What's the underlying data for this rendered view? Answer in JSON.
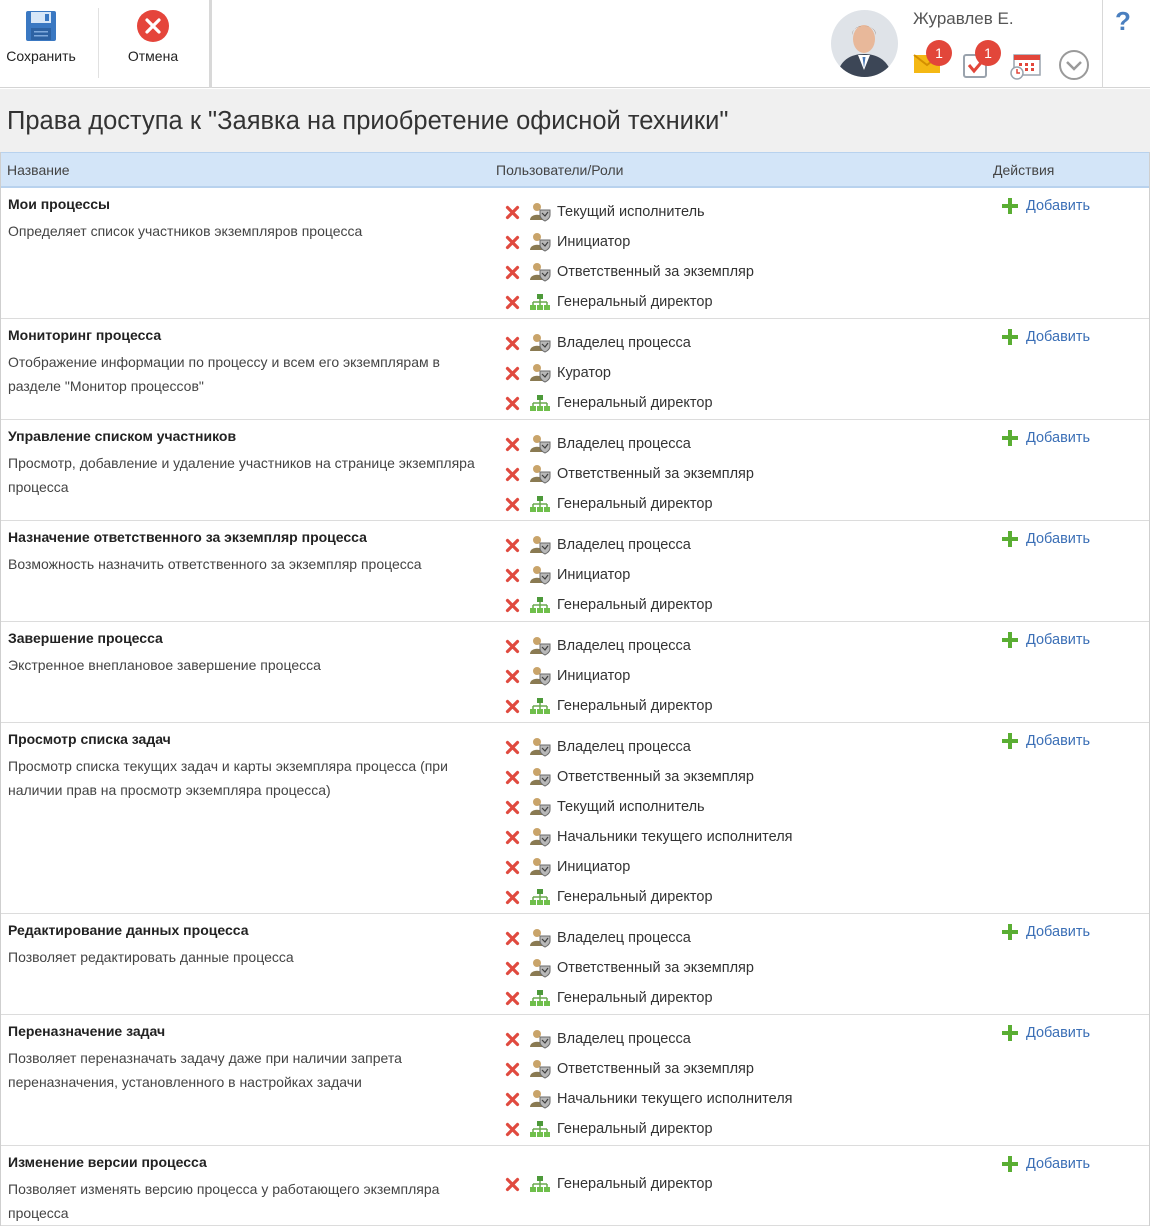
{
  "toolbar": {
    "save_label": "Сохранить",
    "cancel_label": "Отмена"
  },
  "user": {
    "name": "Журавлев Е.",
    "messages_badge": "1",
    "tasks_badge": "1"
  },
  "help_label": "?",
  "page_title": "Права доступа к \"Заявка на приобретение офисной техники\"",
  "table": {
    "headers": {
      "name": "Название",
      "users": "Пользователи/Роли",
      "actions": "Действия"
    },
    "add_label": "Добавить",
    "rows": [
      {
        "name": "Мои процессы",
        "description": "Определяет список участников экземпляров процесса",
        "roles": [
          {
            "label": "Текущий исполнитель",
            "icon": "role-icon"
          },
          {
            "label": "Инициатор",
            "icon": "role-icon"
          },
          {
            "label": "Ответственный за экземпляр",
            "icon": "role-icon"
          },
          {
            "label": "Генеральный директор",
            "icon": "orgchart-icon"
          }
        ]
      },
      {
        "name": "Мониторинг процесса",
        "description": "Отображение информации по процессу и всем его экземплярам в разделе \"Монитор процессов\"",
        "roles": [
          {
            "label": "Владелец процесса",
            "icon": "role-icon"
          },
          {
            "label": "Куратор",
            "icon": "role-icon"
          },
          {
            "label": "Генеральный директор",
            "icon": "orgchart-icon"
          }
        ]
      },
      {
        "name": "Управление списком участников",
        "description": "Просмотр, добавление и удаление участников на странице экземпляра процесса",
        "roles": [
          {
            "label": "Владелец процесса",
            "icon": "role-icon"
          },
          {
            "label": "Ответственный за экземпляр",
            "icon": "role-icon"
          },
          {
            "label": "Генеральный директор",
            "icon": "orgchart-icon"
          }
        ]
      },
      {
        "name": "Назначение ответственного за экземпляр процесса",
        "description": "Возможность назначить ответственного за экземпляр процесса",
        "roles": [
          {
            "label": "Владелец процесса",
            "icon": "role-icon"
          },
          {
            "label": "Инициатор",
            "icon": "role-icon"
          },
          {
            "label": "Генеральный директор",
            "icon": "orgchart-icon"
          }
        ]
      },
      {
        "name": "Завершение процесса",
        "description": "Экстренное внеплановое завершение процесса",
        "roles": [
          {
            "label": "Владелец процесса",
            "icon": "role-icon"
          },
          {
            "label": "Инициатор",
            "icon": "role-icon"
          },
          {
            "label": "Генеральный директор",
            "icon": "orgchart-icon"
          }
        ]
      },
      {
        "name": "Просмотр списка задач",
        "description": "Просмотр списка текущих задач и карты экземпляра процесса (при наличии прав на просмотр экземпляра процесса)",
        "roles": [
          {
            "label": "Владелец процесса",
            "icon": "role-icon"
          },
          {
            "label": "Ответственный за экземпляр",
            "icon": "role-icon"
          },
          {
            "label": "Текущий исполнитель",
            "icon": "role-icon"
          },
          {
            "label": "Начальники текущего исполнителя",
            "icon": "role-icon"
          },
          {
            "label": "Инициатор",
            "icon": "role-icon"
          },
          {
            "label": "Генеральный директор",
            "icon": "orgchart-icon"
          }
        ]
      },
      {
        "name": "Редактирование данных процесса",
        "description": "Позволяет редактировать данные процесса",
        "roles": [
          {
            "label": "Владелец процесса",
            "icon": "role-icon"
          },
          {
            "label": "Ответственный за экземпляр",
            "icon": "role-icon"
          },
          {
            "label": "Генеральный директор",
            "icon": "orgchart-icon"
          }
        ]
      },
      {
        "name": "Переназначение задач",
        "description": "Позволяет переназначать задачу даже при наличии запрета переназначения, установленного в настройках задачи",
        "roles": [
          {
            "label": "Владелец процесса",
            "icon": "role-icon"
          },
          {
            "label": "Ответственный за экземпляр",
            "icon": "role-icon"
          },
          {
            "label": "Начальники текущего исполнителя",
            "icon": "role-icon"
          },
          {
            "label": "Генеральный директор",
            "icon": "orgchart-icon"
          }
        ]
      },
      {
        "name": "Изменение версии процесса",
        "description": "Позволяет изменять версию процесса у работающего экземпляра процесса",
        "roles": [
          {
            "label": "Генеральный директор",
            "icon": "orgchart-icon"
          }
        ]
      }
    ]
  }
}
